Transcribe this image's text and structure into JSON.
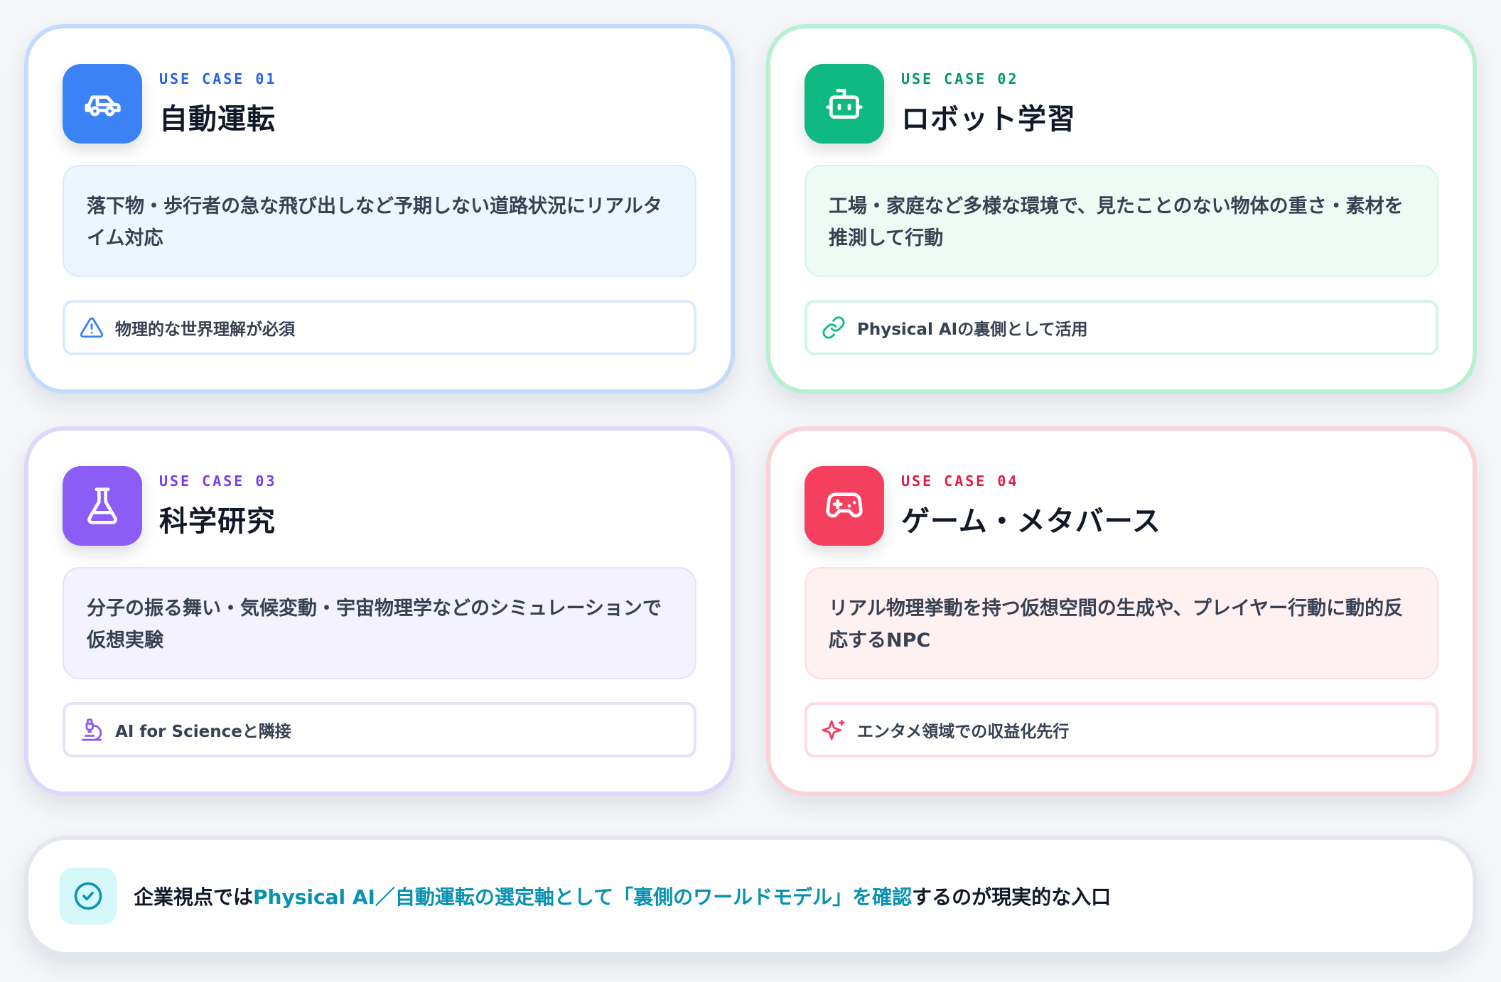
{
  "cards": [
    {
      "eyebrow": "USE CASE 01",
      "title": "自動運転",
      "description": "落下物・歩行者の急な飛び出しなど予期しない道路状況にリアルタイム対応",
      "tag": "物理的な世界理解が必須",
      "icon": "car-icon",
      "tag_icon": "warning-icon",
      "accent_color": "#3b82f6"
    },
    {
      "eyebrow": "USE CASE 02",
      "title": "ロボット学習",
      "description": "工場・家庭など多様な環境で、見たことのない物体の重さ・素材を推測して行動",
      "tag": "Physical AIの裏側として活用",
      "icon": "robot-icon",
      "tag_icon": "link-icon",
      "accent_color": "#10b981"
    },
    {
      "eyebrow": "USE CASE 03",
      "title": "科学研究",
      "description": "分子の振る舞い・気候変動・宇宙物理学などのシミュレーションで仮想実験",
      "tag": "AI for Scienceと隣接",
      "icon": "flask-icon",
      "tag_icon": "microscope-icon",
      "accent_color": "#8b5cf6"
    },
    {
      "eyebrow": "USE CASE 04",
      "title": "ゲーム・メタバース",
      "description": "リアル物理挙動を持つ仮想空間の生成や、プレイヤー行動に動的反応するNPC",
      "tag": "エンタメ領域での収益化先行",
      "icon": "gamepad-icon",
      "tag_icon": "sparkles-icon",
      "accent_color": "#f43f5e"
    }
  ],
  "banner": {
    "prefix": "企業視点では",
    "highlight": "Physical AI／自動運転の選定軸として「裏側のワールドモデル」を確認",
    "suffix": "するのが現実的な入口",
    "icon": "check-circle-icon",
    "accent_color": "#0891b2"
  }
}
